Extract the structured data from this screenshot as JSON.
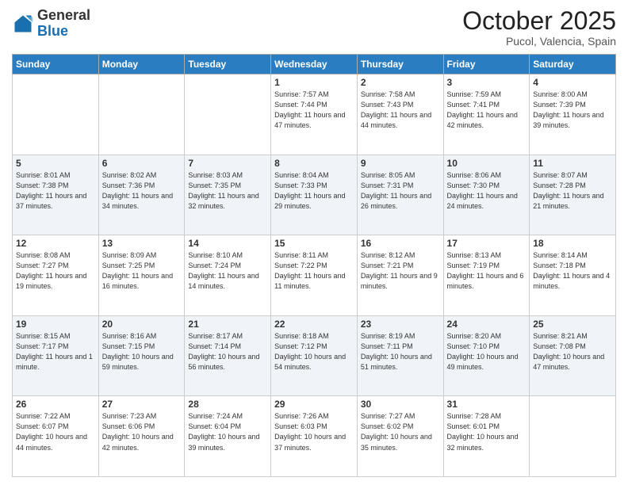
{
  "header": {
    "logo_general": "General",
    "logo_blue": "Blue",
    "month_title": "October 2025",
    "location": "Pucol, Valencia, Spain"
  },
  "days_of_week": [
    "Sunday",
    "Monday",
    "Tuesday",
    "Wednesday",
    "Thursday",
    "Friday",
    "Saturday"
  ],
  "weeks": [
    [
      {
        "day": "",
        "sunrise": "",
        "sunset": "",
        "daylight": ""
      },
      {
        "day": "",
        "sunrise": "",
        "sunset": "",
        "daylight": ""
      },
      {
        "day": "",
        "sunrise": "",
        "sunset": "",
        "daylight": ""
      },
      {
        "day": "1",
        "sunrise": "Sunrise: 7:57 AM",
        "sunset": "Sunset: 7:44 PM",
        "daylight": "Daylight: 11 hours and 47 minutes."
      },
      {
        "day": "2",
        "sunrise": "Sunrise: 7:58 AM",
        "sunset": "Sunset: 7:43 PM",
        "daylight": "Daylight: 11 hours and 44 minutes."
      },
      {
        "day": "3",
        "sunrise": "Sunrise: 7:59 AM",
        "sunset": "Sunset: 7:41 PM",
        "daylight": "Daylight: 11 hours and 42 minutes."
      },
      {
        "day": "4",
        "sunrise": "Sunrise: 8:00 AM",
        "sunset": "Sunset: 7:39 PM",
        "daylight": "Daylight: 11 hours and 39 minutes."
      }
    ],
    [
      {
        "day": "5",
        "sunrise": "Sunrise: 8:01 AM",
        "sunset": "Sunset: 7:38 PM",
        "daylight": "Daylight: 11 hours and 37 minutes."
      },
      {
        "day": "6",
        "sunrise": "Sunrise: 8:02 AM",
        "sunset": "Sunset: 7:36 PM",
        "daylight": "Daylight: 11 hours and 34 minutes."
      },
      {
        "day": "7",
        "sunrise": "Sunrise: 8:03 AM",
        "sunset": "Sunset: 7:35 PM",
        "daylight": "Daylight: 11 hours and 32 minutes."
      },
      {
        "day": "8",
        "sunrise": "Sunrise: 8:04 AM",
        "sunset": "Sunset: 7:33 PM",
        "daylight": "Daylight: 11 hours and 29 minutes."
      },
      {
        "day": "9",
        "sunrise": "Sunrise: 8:05 AM",
        "sunset": "Sunset: 7:31 PM",
        "daylight": "Daylight: 11 hours and 26 minutes."
      },
      {
        "day": "10",
        "sunrise": "Sunrise: 8:06 AM",
        "sunset": "Sunset: 7:30 PM",
        "daylight": "Daylight: 11 hours and 24 minutes."
      },
      {
        "day": "11",
        "sunrise": "Sunrise: 8:07 AM",
        "sunset": "Sunset: 7:28 PM",
        "daylight": "Daylight: 11 hours and 21 minutes."
      }
    ],
    [
      {
        "day": "12",
        "sunrise": "Sunrise: 8:08 AM",
        "sunset": "Sunset: 7:27 PM",
        "daylight": "Daylight: 11 hours and 19 minutes."
      },
      {
        "day": "13",
        "sunrise": "Sunrise: 8:09 AM",
        "sunset": "Sunset: 7:25 PM",
        "daylight": "Daylight: 11 hours and 16 minutes."
      },
      {
        "day": "14",
        "sunrise": "Sunrise: 8:10 AM",
        "sunset": "Sunset: 7:24 PM",
        "daylight": "Daylight: 11 hours and 14 minutes."
      },
      {
        "day": "15",
        "sunrise": "Sunrise: 8:11 AM",
        "sunset": "Sunset: 7:22 PM",
        "daylight": "Daylight: 11 hours and 11 minutes."
      },
      {
        "day": "16",
        "sunrise": "Sunrise: 8:12 AM",
        "sunset": "Sunset: 7:21 PM",
        "daylight": "Daylight: 11 hours and 9 minutes."
      },
      {
        "day": "17",
        "sunrise": "Sunrise: 8:13 AM",
        "sunset": "Sunset: 7:19 PM",
        "daylight": "Daylight: 11 hours and 6 minutes."
      },
      {
        "day": "18",
        "sunrise": "Sunrise: 8:14 AM",
        "sunset": "Sunset: 7:18 PM",
        "daylight": "Daylight: 11 hours and 4 minutes."
      }
    ],
    [
      {
        "day": "19",
        "sunrise": "Sunrise: 8:15 AM",
        "sunset": "Sunset: 7:17 PM",
        "daylight": "Daylight: 11 hours and 1 minute."
      },
      {
        "day": "20",
        "sunrise": "Sunrise: 8:16 AM",
        "sunset": "Sunset: 7:15 PM",
        "daylight": "Daylight: 10 hours and 59 minutes."
      },
      {
        "day": "21",
        "sunrise": "Sunrise: 8:17 AM",
        "sunset": "Sunset: 7:14 PM",
        "daylight": "Daylight: 10 hours and 56 minutes."
      },
      {
        "day": "22",
        "sunrise": "Sunrise: 8:18 AM",
        "sunset": "Sunset: 7:12 PM",
        "daylight": "Daylight: 10 hours and 54 minutes."
      },
      {
        "day": "23",
        "sunrise": "Sunrise: 8:19 AM",
        "sunset": "Sunset: 7:11 PM",
        "daylight": "Daylight: 10 hours and 51 minutes."
      },
      {
        "day": "24",
        "sunrise": "Sunrise: 8:20 AM",
        "sunset": "Sunset: 7:10 PM",
        "daylight": "Daylight: 10 hours and 49 minutes."
      },
      {
        "day": "25",
        "sunrise": "Sunrise: 8:21 AM",
        "sunset": "Sunset: 7:08 PM",
        "daylight": "Daylight: 10 hours and 47 minutes."
      }
    ],
    [
      {
        "day": "26",
        "sunrise": "Sunrise: 7:22 AM",
        "sunset": "Sunset: 6:07 PM",
        "daylight": "Daylight: 10 hours and 44 minutes."
      },
      {
        "day": "27",
        "sunrise": "Sunrise: 7:23 AM",
        "sunset": "Sunset: 6:06 PM",
        "daylight": "Daylight: 10 hours and 42 minutes."
      },
      {
        "day": "28",
        "sunrise": "Sunrise: 7:24 AM",
        "sunset": "Sunset: 6:04 PM",
        "daylight": "Daylight: 10 hours and 39 minutes."
      },
      {
        "day": "29",
        "sunrise": "Sunrise: 7:26 AM",
        "sunset": "Sunset: 6:03 PM",
        "daylight": "Daylight: 10 hours and 37 minutes."
      },
      {
        "day": "30",
        "sunrise": "Sunrise: 7:27 AM",
        "sunset": "Sunset: 6:02 PM",
        "daylight": "Daylight: 10 hours and 35 minutes."
      },
      {
        "day": "31",
        "sunrise": "Sunrise: 7:28 AM",
        "sunset": "Sunset: 6:01 PM",
        "daylight": "Daylight: 10 hours and 32 minutes."
      },
      {
        "day": "",
        "sunrise": "",
        "sunset": "",
        "daylight": ""
      }
    ]
  ]
}
